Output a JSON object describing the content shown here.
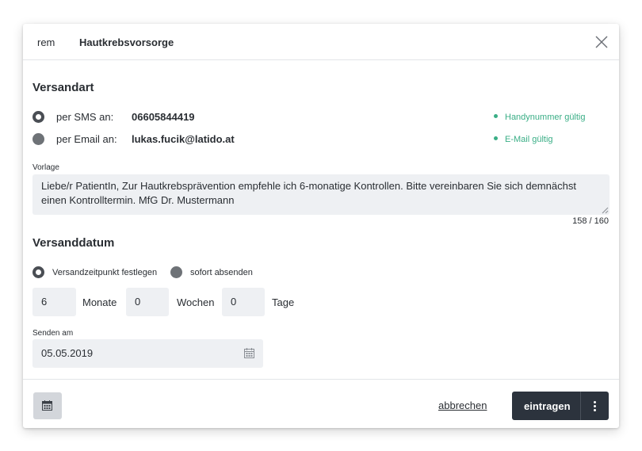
{
  "header": {
    "code": "rem",
    "title": "Hautkrebsvorsorge"
  },
  "versandart": {
    "title": "Versandart",
    "sms": {
      "label": "per SMS an:",
      "value": "06605844419",
      "status": "Handynummer gültig",
      "selected": true
    },
    "email": {
      "label": "per Email an:",
      "value": "lukas.fucik@latido.at",
      "status": "E-Mail gültig",
      "selected": false
    },
    "status_color": "#3aae86"
  },
  "vorlage": {
    "label": "Vorlage",
    "text": "Liebe/r PatientIn, Zur Hautkrebsprävention empfehle ich 6-monatige Kontrollen. Bitte vereinbaren Sie sich demnächst einen Kontrolltermin.  MfG Dr. Mustermann",
    "counter": "158 / 160"
  },
  "versanddatum": {
    "title": "Versanddatum",
    "option_schedule": "Versandzeitpunkt festlegen",
    "option_now": "sofort absenden",
    "months_value": "6",
    "months_label": "Monate",
    "weeks_value": "0",
    "weeks_label": "Wochen",
    "days_value": "0",
    "days_label": "Tage",
    "send_on_label": "Senden am",
    "send_on_value": "05.05.2019"
  },
  "footer": {
    "cancel_label": "abbrechen",
    "submit_label": "eintragen"
  },
  "colors": {
    "primary_button": "#2c333d",
    "field_background": "#eef0f3"
  }
}
